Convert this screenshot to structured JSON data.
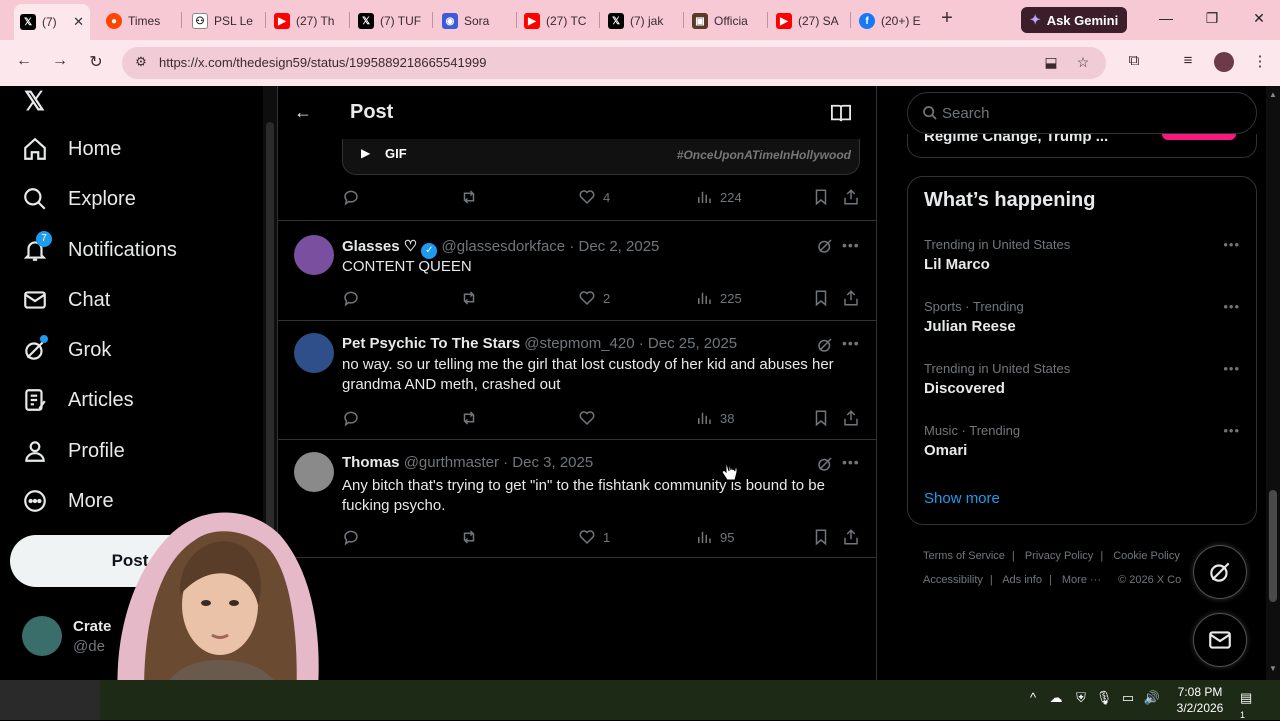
{
  "browser": {
    "tabs": [
      {
        "label": "(7)",
        "icon": "x-logo",
        "active": true
      },
      {
        "label": "Times",
        "icon": "reddit-icon"
      },
      {
        "label": "PSL Le",
        "icon": "psl-icon"
      },
      {
        "label": "(27) Th",
        "icon": "youtube-icon"
      },
      {
        "label": "(7) TUF",
        "icon": "x-logo"
      },
      {
        "label": "Sora",
        "icon": "sora-icon"
      },
      {
        "label": "(27) TC",
        "icon": "youtube-icon"
      },
      {
        "label": "(7) jak",
        "icon": "x-logo"
      },
      {
        "label": "Officia",
        "icon": "site-icon"
      },
      {
        "label": "(27) SA",
        "icon": "youtube-icon"
      },
      {
        "label": "(20+) E",
        "icon": "facebook-icon"
      }
    ],
    "new_tab": "+",
    "ask_gemini": "Ask Gemini",
    "url": "https://x.com/thedesign59/status/1995889218665541999",
    "colors": {
      "tabbar": "#f6c9d4",
      "toolbar": "#fbe7ec"
    }
  },
  "nav": {
    "items": [
      {
        "label": "Home",
        "icon": "home-icon"
      },
      {
        "label": "Explore",
        "icon": "search-icon"
      },
      {
        "label": "Notifications",
        "icon": "bell-icon",
        "badge": "7"
      },
      {
        "label": "Chat",
        "icon": "mail-icon"
      },
      {
        "label": "Grok",
        "icon": "grok-icon"
      },
      {
        "label": "Articles",
        "icon": "articles-icon"
      },
      {
        "label": "Profile",
        "icon": "person-icon"
      },
      {
        "label": "More",
        "icon": "more-circle-icon"
      }
    ],
    "post_button": "Post",
    "account": {
      "name": "Crate",
      "handle": "@de"
    }
  },
  "main": {
    "title": "Post",
    "gif": {
      "label": "GIF",
      "hashtag": "#OnceUponATimeInHollywood"
    },
    "top_actions": {
      "likes": "4",
      "views": "224"
    },
    "replies": [
      {
        "name": "Glasses ♡",
        "verified": true,
        "handle": "@glassesdorkface",
        "date": "Dec 2, 2025",
        "text": "CONTENT QUEEN",
        "likes": "2",
        "views": "225",
        "avatar_color": "#7a4fa0"
      },
      {
        "name": "Pet Psychic To The Stars",
        "verified": false,
        "handle": "@stepmom_420",
        "date": "Dec 25, 2025",
        "text": "no way. so ur telling me the girl that lost custody of her kid and abuses her grandma AND meth, crashed out",
        "likes": "",
        "views": "38",
        "avatar_color": "#2e4f8a"
      },
      {
        "name": "Thomas",
        "verified": false,
        "handle": "@gurthmaster",
        "date": "Dec 3, 2025",
        "text": "Any bitch that's trying to get \"in\" to the fishtank community is bound to be fucking psycho.",
        "likes": "1",
        "views": "95",
        "avatar_color": "#8a8a8a"
      }
    ]
  },
  "sidebar": {
    "search_placeholder": "Search",
    "preview_text": "Regime Change, Trump ...",
    "trends_title": "What’s happening",
    "trends": [
      {
        "context": "Trending in United States",
        "name": "Lil Marco"
      },
      {
        "context": "Sports · Trending",
        "name": "Julian Reese"
      },
      {
        "context": "Trending in United States",
        "name": "Discovered"
      },
      {
        "context": "Music · Trending",
        "name": "Omari"
      }
    ],
    "show_more": "Show more",
    "footer": {
      "row1": [
        "Terms of Service",
        "Privacy Policy",
        "Cookie Policy"
      ],
      "row2": [
        "Accessibility",
        "Ads info",
        "More ···",
        "© 2026 X Co"
      ]
    }
  },
  "taskbar": {
    "time": "7:08 PM",
    "date": "3/2/2026",
    "notification_count": "1"
  }
}
